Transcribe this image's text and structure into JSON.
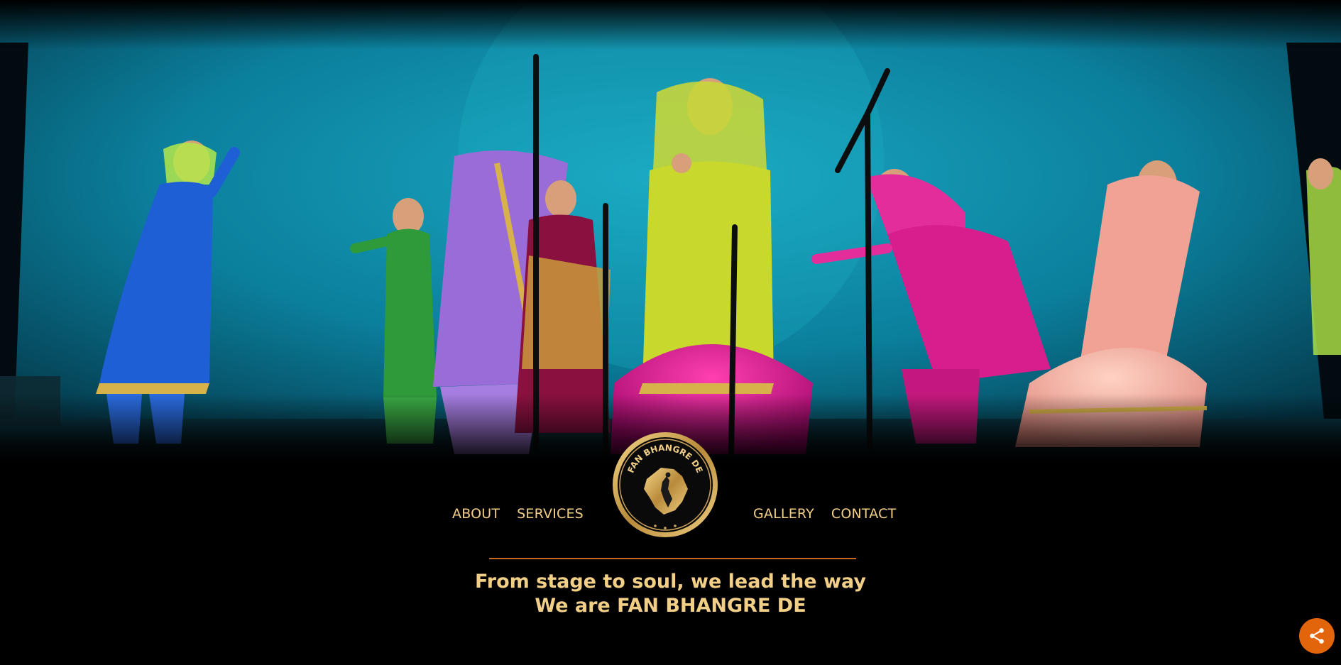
{
  "hero": {
    "image_alt": "Bhangra/Giddha dancers performing on stage in colorful Punjabi suits",
    "background_color": "#0b7f9c"
  },
  "nav": {
    "left": [
      "ABOUT",
      "SERVICES"
    ],
    "right": [
      "GALLERY",
      "CONTACT"
    ]
  },
  "logo": {
    "text": "FAN BHANGRE DE",
    "icon": "punjab-map-dancer-icon"
  },
  "tagline": {
    "line1": "From stage to soul, we lead the way",
    "line2": "We are FAN BHANGRE DE"
  },
  "share": {
    "icon": "share-icon",
    "color": "#e2650b"
  },
  "colors": {
    "accent_text": "#f2cf86",
    "divider": "#c46a1a",
    "background": "#000000"
  }
}
